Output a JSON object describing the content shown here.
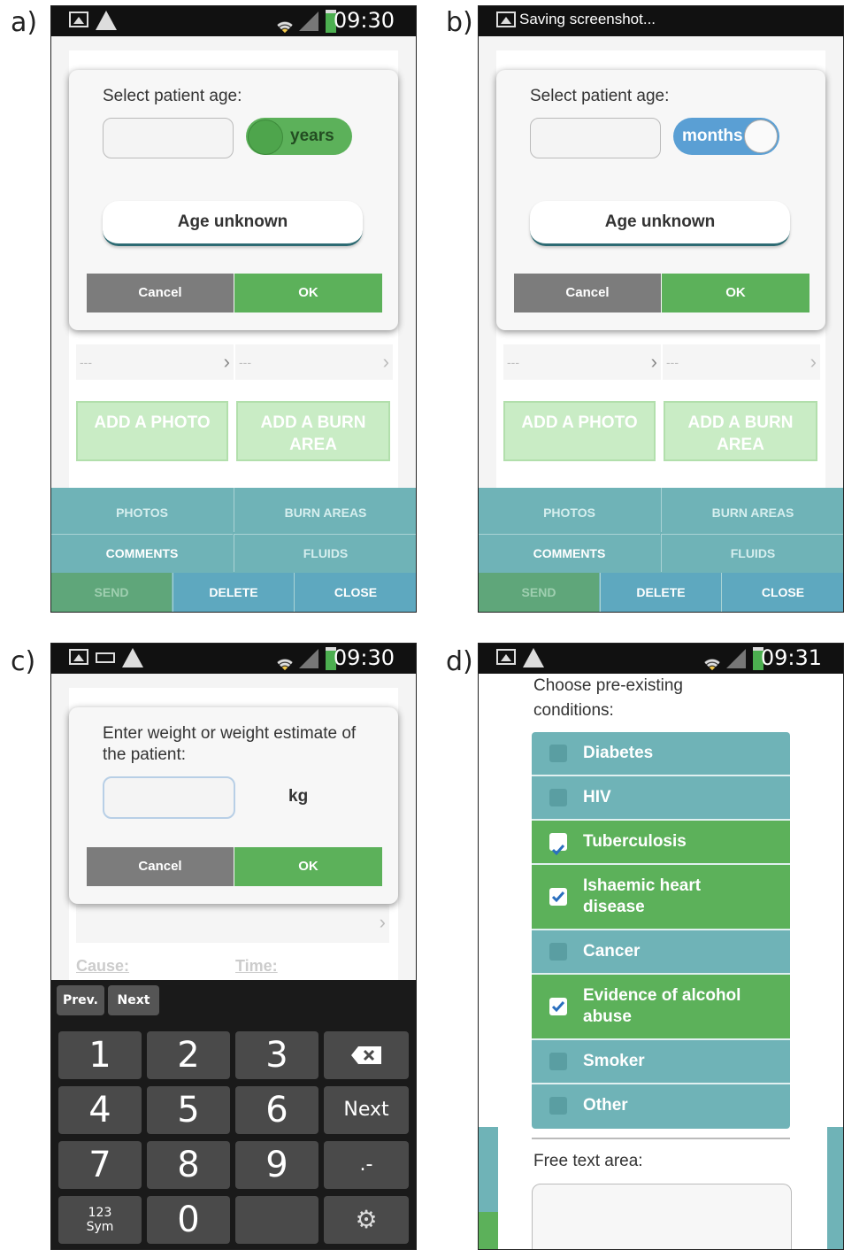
{
  "panels": {
    "a": {
      "label": "a)",
      "time": "09:30"
    },
    "b": {
      "label": "b)",
      "notification": "Saving screenshot..."
    },
    "c": {
      "label": "c)",
      "time": "09:30"
    },
    "d": {
      "label": "d)",
      "time": "09:31"
    }
  },
  "age_dialog": {
    "prompt": "Select patient age:",
    "toggle_years": "years",
    "toggle_months": "months",
    "age_unknown": "Age unknown",
    "cancel": "Cancel",
    "ok": "OK"
  },
  "form_rows": {
    "placeholder": "---",
    "chevron": "›"
  },
  "add_buttons": {
    "photo": "ADD A PHOTO",
    "burn": "ADD A BURN AREA"
  },
  "tabs": {
    "photos": "PHOTOS",
    "burn_areas": "BURN AREAS",
    "comments": "COMMENTS",
    "fluids": "FLUIDS",
    "send": "SEND",
    "delete": "DELETE",
    "close": "CLOSE"
  },
  "weight_dialog": {
    "prompt": "Enter weight or weight estimate of the patient:",
    "unit": "kg",
    "cancel": "Cancel",
    "ok": "OK"
  },
  "background_labels": {
    "cause": "Cause:",
    "time": "Time:"
  },
  "keyboard": {
    "prev": "Prev.",
    "next_small": "Next",
    "keys": [
      "1",
      "2",
      "3",
      "4",
      "5",
      "6",
      "7",
      "8",
      "9",
      "0"
    ],
    "next": "Next",
    "dotdash": ".-",
    "sym_top": "123",
    "sym_bottom": "Sym"
  },
  "conditions": {
    "title": "Choose pre-existing conditions:",
    "items": [
      {
        "label": "Diabetes",
        "checked": false
      },
      {
        "label": "HIV",
        "checked": false
      },
      {
        "label": "Tuberculosis",
        "checked": true
      },
      {
        "label": "Ishaemic heart disease",
        "checked": true
      },
      {
        "label": "Cancer",
        "checked": false
      },
      {
        "label": "Evidence of alcohol abuse",
        "checked": true
      },
      {
        "label": "Smoker",
        "checked": false
      },
      {
        "label": "Other",
        "checked": false
      }
    ],
    "free_text_label": "Free text area:"
  },
  "colors": {
    "green": "#5cb15a",
    "teal": "#6fb3b7",
    "gray": "#7c7c7c",
    "blue": "#5a9fd4"
  }
}
